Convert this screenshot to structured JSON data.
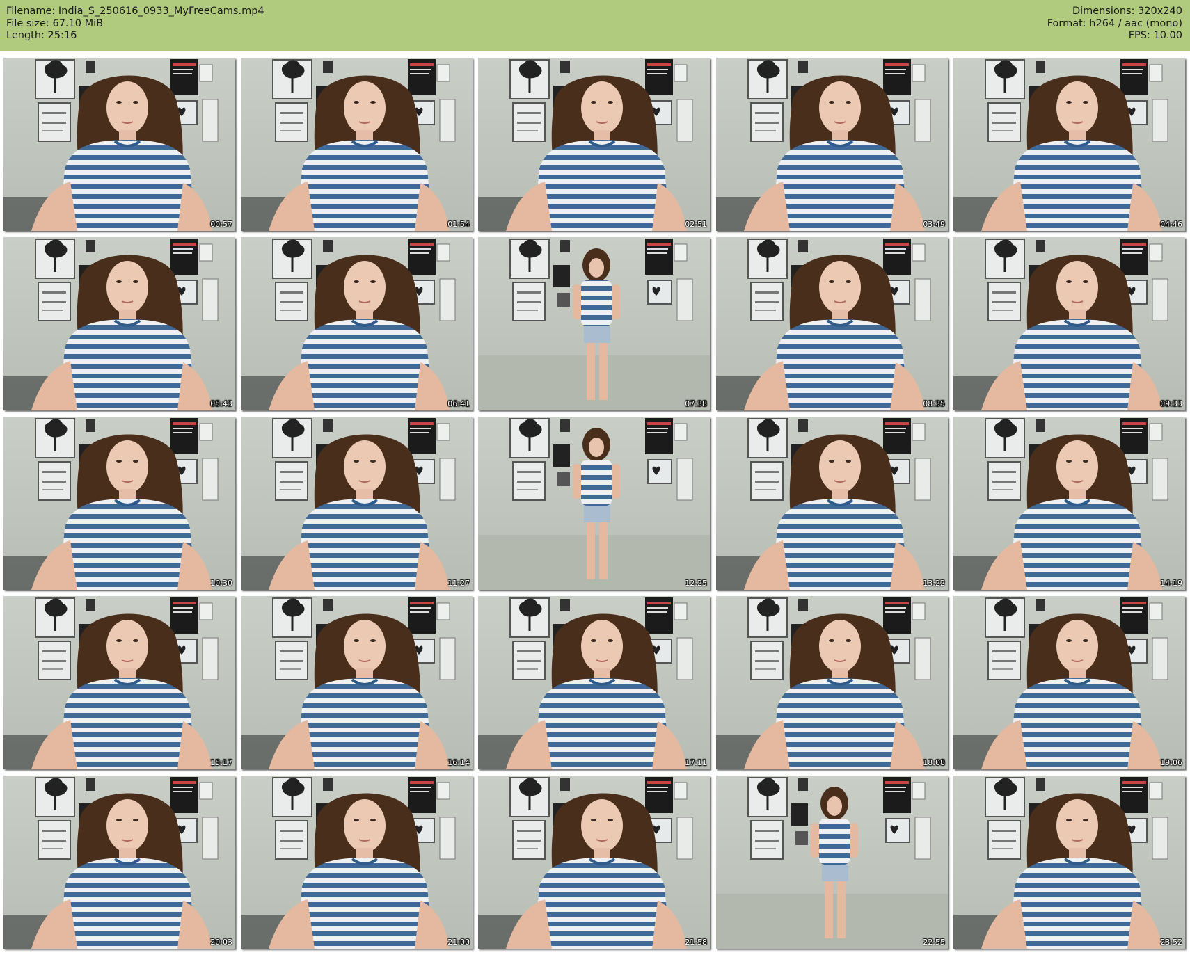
{
  "header": {
    "filename_line": "Filename: India_S_250616_0933_MyFreeCams.mp4",
    "filesize_line": "File size: 67.10 MiB",
    "length_line": "Length: 25:16",
    "dimensions_line": "Dimensions: 320x240",
    "format_line": "Format: h264 / aac (mono)",
    "fps_line": "FPS: 10.00",
    "background_color": "#b1cb7e"
  },
  "thumbnails": [
    {
      "timestamp": "00:57",
      "pose": "seated"
    },
    {
      "timestamp": "01:54",
      "pose": "seated"
    },
    {
      "timestamp": "02:51",
      "pose": "seated"
    },
    {
      "timestamp": "03:49",
      "pose": "seated"
    },
    {
      "timestamp": "04:46",
      "pose": "seated"
    },
    {
      "timestamp": "05:43",
      "pose": "seated"
    },
    {
      "timestamp": "06:41",
      "pose": "seated"
    },
    {
      "timestamp": "07:38",
      "pose": "standing"
    },
    {
      "timestamp": "08:35",
      "pose": "seated"
    },
    {
      "timestamp": "09:33",
      "pose": "seated"
    },
    {
      "timestamp": "10:30",
      "pose": "seated"
    },
    {
      "timestamp": "11:27",
      "pose": "seated"
    },
    {
      "timestamp": "12:25",
      "pose": "standing"
    },
    {
      "timestamp": "13:22",
      "pose": "seated"
    },
    {
      "timestamp": "14:19",
      "pose": "seated"
    },
    {
      "timestamp": "15:17",
      "pose": "seated"
    },
    {
      "timestamp": "16:14",
      "pose": "seated"
    },
    {
      "timestamp": "17:11",
      "pose": "seated"
    },
    {
      "timestamp": "18:08",
      "pose": "seated"
    },
    {
      "timestamp": "19:06",
      "pose": "seated"
    },
    {
      "timestamp": "20:03",
      "pose": "seated"
    },
    {
      "timestamp": "21:00",
      "pose": "seated"
    },
    {
      "timestamp": "21:58",
      "pose": "seated"
    },
    {
      "timestamp": "22:55",
      "pose": "standing"
    },
    {
      "timestamp": "23:52",
      "pose": "seated"
    }
  ]
}
